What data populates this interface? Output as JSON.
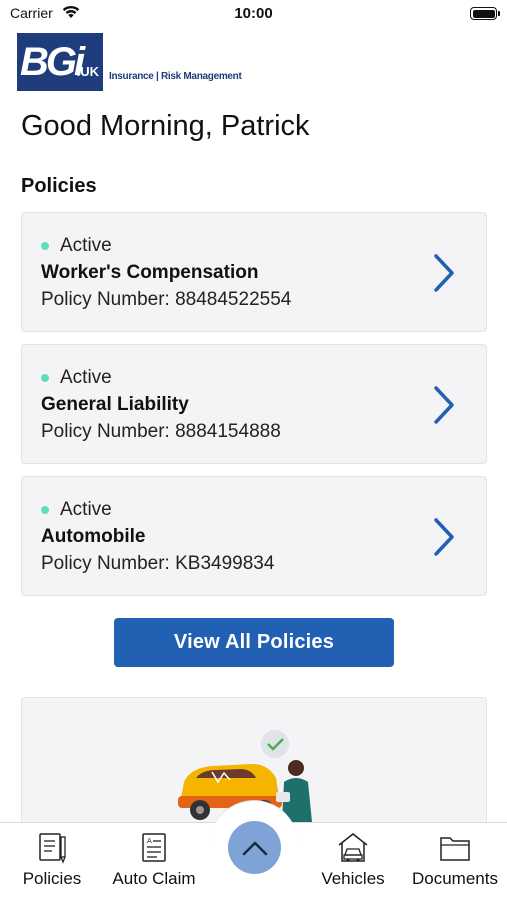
{
  "status_bar": {
    "carrier": "Carrier",
    "time": "10:00"
  },
  "logo": {
    "mark": "BGi",
    "suffix": ".UK",
    "tagline": "Insurance | Risk Management"
  },
  "greeting": "Good Morning, Patrick",
  "policies_title": "Policies",
  "policies": [
    {
      "status": "Active",
      "name": "Worker's Compensation",
      "number_label": "Policy Number: 88484522554"
    },
    {
      "status": "Active",
      "name": "General Liability",
      "number_label": "Policy Number: 8884154888"
    },
    {
      "status": "Active",
      "name": "Automobile",
      "number_label": "Policy Number: KB3499834"
    }
  ],
  "view_all_label": "View All Policies",
  "tabs": [
    {
      "label": "Policies",
      "icon": "document-pen-icon"
    },
    {
      "label": "Auto Claim",
      "icon": "claim-form-icon"
    },
    {
      "label": "Vehicles",
      "icon": "car-garage-icon"
    },
    {
      "label": "Documents",
      "icon": "folder-icon"
    }
  ],
  "colors": {
    "brand": "#1f3c7c",
    "accent": "#2260b4",
    "active": "#5de0b8",
    "fab": "#7fa3d6"
  }
}
